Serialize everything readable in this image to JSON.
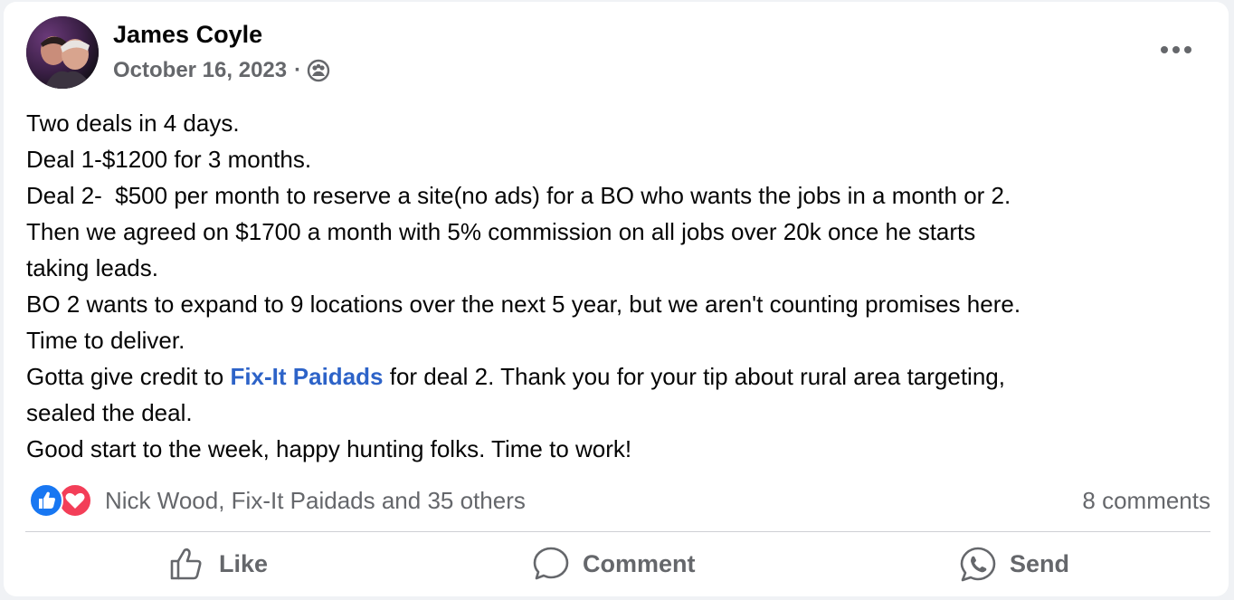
{
  "post": {
    "author": "James Coyle",
    "date": "October 16, 2023",
    "separator": "·",
    "audience_icon": "group-audience-icon",
    "more_icon": "more-options-icon",
    "body_lines": [
      "Two deals in 4 days.",
      "Deal 1-$1200 for 3 months.",
      "Deal 2-  $500 per month to reserve a site(no ads) for a BO who wants the jobs in a month or 2.",
      "Then we agreed on $1700 a month with 5% commission on all jobs over 20k once he starts",
      "taking leads.",
      "BO 2 wants to expand to 9 locations over the next 5 year, but we aren't counting promises here.",
      "Time to deliver."
    ],
    "credit_line": {
      "before": "Gotta give credit to ",
      "mention": "Fix-It Paidads",
      "after": " for deal 2. Thank you for your tip about rural area targeting,"
    },
    "closing_lines": [
      "sealed the deal.",
      "Good start to the week, happy hunting folks. Time to work!"
    ]
  },
  "reactions": {
    "icons": [
      "like-reaction-icon",
      "love-reaction-icon"
    ],
    "summary": "Nick Wood, Fix-It Paidads and 35 others",
    "comments": "8 comments"
  },
  "actions": {
    "like": "Like",
    "comment": "Comment",
    "send": "Send"
  },
  "colors": {
    "link": "#2d63c8",
    "secondary_text": "#65676b",
    "like_blue": "#1877f2",
    "love_red": "#f33e58"
  }
}
